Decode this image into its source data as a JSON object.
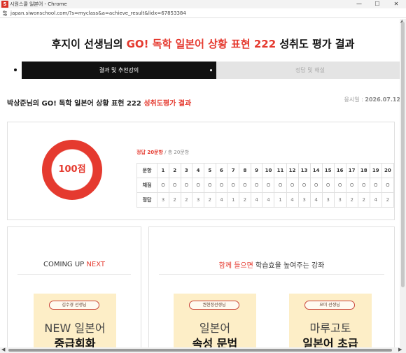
{
  "window": {
    "title": "시원스쿨 일본어 - Chrome",
    "url": "japan.siwonschool.com/?s=myclass&a=achieve_result&lidx=67853384"
  },
  "header": {
    "title_prefix": "후지이 선생님의 ",
    "title_accent": "GO! 독학 일본어 상황 표현 222",
    "title_suffix": " 성취도 평가 결과"
  },
  "tabs": [
    {
      "label": "결과 및 추천강의",
      "active": true
    },
    {
      "label": "정답 및 해설",
      "active": false
    }
  ],
  "result": {
    "subtitle_prefix": "박상준님의 GO! 독학 일본어 상황 표현 222 ",
    "subtitle_accent": "성취도평가 결과",
    "exam_date_label": "응시일 : ",
    "exam_date": "2026.07.12",
    "score_label": "100점",
    "score_fraction": 1.0,
    "correct_text": "정답 20문항",
    "total_text": " / 총 20문항",
    "row_labels": {
      "question": "문항",
      "grade": "채점",
      "answer": "정답"
    },
    "questions": [
      "1",
      "2",
      "3",
      "4",
      "5",
      "6",
      "7",
      "8",
      "9",
      "10",
      "11",
      "12",
      "13",
      "14",
      "15",
      "16",
      "17",
      "18",
      "19",
      "20"
    ],
    "grades": [
      "O",
      "O",
      "O",
      "O",
      "O",
      "O",
      "O",
      "O",
      "O",
      "O",
      "O",
      "O",
      "O",
      "O",
      "O",
      "O",
      "O",
      "O",
      "O",
      "O"
    ],
    "answers": [
      "3",
      "2",
      "2",
      "3",
      "2",
      "4",
      "1",
      "2",
      "4",
      "4",
      "1",
      "4",
      "3",
      "4",
      "3",
      "3",
      "2",
      "2",
      "4",
      "2"
    ]
  },
  "coming_up": {
    "title_prefix": "COMING UP ",
    "title_accent": "NEXT",
    "card": {
      "tag": "김수경 선생님",
      "line1": "NEW 일본어",
      "line2": "중급회화"
    }
  },
  "recommend": {
    "title_accent": "함께 들으면",
    "title_suffix": " 학습효율 높여주는 강좌",
    "cards": [
      {
        "tag": "권현정선생님",
        "line1": "일본어",
        "line2": "속성 문법"
      },
      {
        "tag": "요미 선생님",
        "line1": "마루고토",
        "line2": "일본어 초급"
      }
    ]
  },
  "colors": {
    "accent": "#e53a2f",
    "tab_active": "#111111",
    "card_bg": "#fdeec7"
  }
}
